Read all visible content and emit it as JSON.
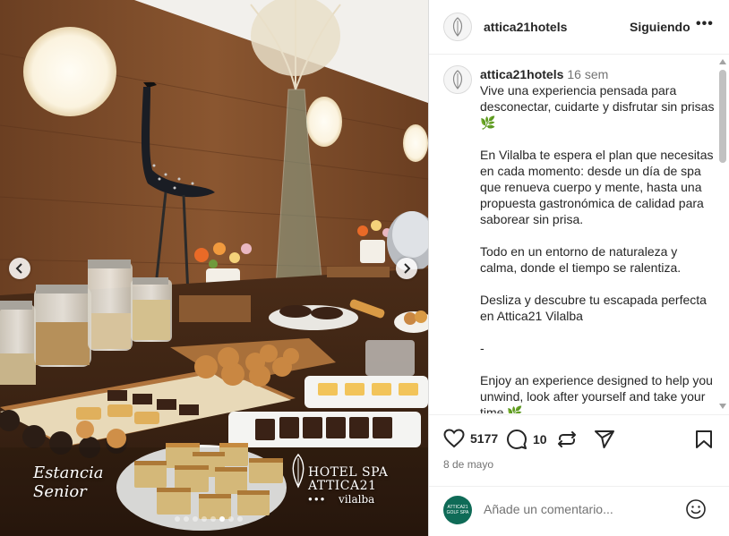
{
  "header": {
    "username": "attica21hotels",
    "follow_label": "Siguiendo",
    "more_label": "•••",
    "avatar_icon": "hotel-logo-icon"
  },
  "caption": {
    "username": "attica21hotels",
    "time_ago": "16 sem",
    "paragraphs": [
      "Vive una experiencia pensada para desconectar, cuidarte y disfrutar sin prisas🌿",
      "En Vilalba te espera el plan que necesitas en cada momento: desde un día de spa que renueva cuerpo y mente, hasta una propuesta gastronómica de calidad para saborear sin prisa.",
      "Todo en un entorno de naturaleza y calma, donde el tiempo se ralentiza.",
      "Desliza y descubre tu escapada perfecta en Attica21 Vilalba",
      "-",
      "Enjoy an experience designed to help you unwind, look after yourself and take your time 🌿"
    ]
  },
  "actions": {
    "likes_count": "5177",
    "comments_count": "10",
    "date": "8 de mayo"
  },
  "comment_box": {
    "placeholder": "Añade un comentario...",
    "avatar_text": "ATTICA21 GOLF SPA"
  },
  "photo": {
    "overlay_left_line1": "Estancia",
    "overlay_left_line2": "Senior",
    "overlay_right_line1": "HOTEL SPA",
    "overlay_right_line2": "ATTICA21",
    "overlay_right_line3": "vilalba",
    "carousel_total": 8,
    "carousel_active": 5
  },
  "colors": {
    "wood": "#7a4a2a",
    "text": "#262626",
    "muted": "#737373",
    "divider": "#efefef"
  }
}
